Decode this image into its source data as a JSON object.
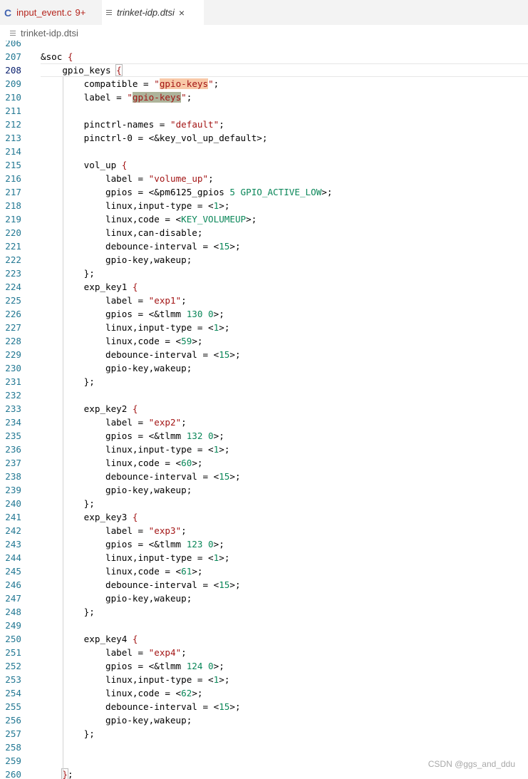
{
  "tabs": [
    {
      "icon": "C",
      "label": "input_event.c",
      "badge": "9+",
      "active": false
    },
    {
      "icon": "file-lines-icon",
      "label": "trinket-idp.dtsi",
      "close": "×",
      "active": true
    }
  ],
  "breadcrumb": {
    "file": "trinket-idp.dtsi"
  },
  "editor": {
    "lines": [
      {
        "n": "206",
        "t": []
      },
      {
        "n": "207",
        "t": [
          [
            "&soc ",
            ""
          ],
          [
            "{",
            "p"
          ]
        ]
      },
      {
        "n": "208",
        "t": [
          [
            "    gpio_keys ",
            ""
          ],
          [
            "{",
            "cursor"
          ]
        ]
      },
      {
        "n": "209",
        "t": [
          [
            "        compatible = ",
            ""
          ],
          [
            "\"",
            "s"
          ],
          [
            "gpio-keys",
            "hl1"
          ],
          [
            "\"",
            "s"
          ],
          [
            ";",
            ""
          ]
        ]
      },
      {
        "n": "210",
        "t": [
          [
            "        label = ",
            ""
          ],
          [
            "\"",
            "s"
          ],
          [
            "gpio-keys",
            "hl2"
          ],
          [
            "\"",
            "s"
          ],
          [
            ";",
            ""
          ]
        ]
      },
      {
        "n": "211",
        "t": []
      },
      {
        "n": "212",
        "t": [
          [
            "        pinctrl-names = ",
            ""
          ],
          [
            "\"default\"",
            "s"
          ],
          [
            ";",
            ""
          ]
        ]
      },
      {
        "n": "213",
        "t": [
          [
            "        pinctrl-0 = <&key_vol_up_default>;",
            ""
          ]
        ]
      },
      {
        "n": "214",
        "t": []
      },
      {
        "n": "215",
        "t": [
          [
            "        vol_up ",
            ""
          ],
          [
            "{",
            "p"
          ]
        ]
      },
      {
        "n": "216",
        "t": [
          [
            "            label = ",
            ""
          ],
          [
            "\"volume_up\"",
            "s"
          ],
          [
            ";",
            ""
          ]
        ]
      },
      {
        "n": "217",
        "t": [
          [
            "            gpios = <&pm6125_gpios ",
            ""
          ],
          [
            "5 GPIO_ACTIVE_LOW",
            "n"
          ],
          [
            ">;",
            ""
          ]
        ]
      },
      {
        "n": "218",
        "t": [
          [
            "            linux,input-type = <",
            ""
          ],
          [
            "1",
            "n"
          ],
          [
            ">;",
            ""
          ]
        ]
      },
      {
        "n": "219",
        "t": [
          [
            "            linux,code = <",
            ""
          ],
          [
            "KEY_VOLUMEUP",
            "n"
          ],
          [
            ">;",
            ""
          ]
        ]
      },
      {
        "n": "220",
        "t": [
          [
            "            linux,can-disable;",
            ""
          ]
        ]
      },
      {
        "n": "221",
        "t": [
          [
            "            debounce-interval = <",
            ""
          ],
          [
            "15",
            "n"
          ],
          [
            ">;",
            ""
          ]
        ]
      },
      {
        "n": "222",
        "t": [
          [
            "            gpio-key,wakeup;",
            ""
          ]
        ]
      },
      {
        "n": "223",
        "t": [
          [
            "        };",
            ""
          ]
        ]
      },
      {
        "n": "224",
        "t": [
          [
            "        exp_key1 ",
            ""
          ],
          [
            "{",
            "p"
          ]
        ]
      },
      {
        "n": "225",
        "t": [
          [
            "            label = ",
            ""
          ],
          [
            "\"exp1\"",
            "s"
          ],
          [
            ";",
            ""
          ]
        ]
      },
      {
        "n": "226",
        "t": [
          [
            "            gpios = <&tlmm ",
            ""
          ],
          [
            "130 0",
            "n"
          ],
          [
            ">;",
            ""
          ]
        ]
      },
      {
        "n": "227",
        "t": [
          [
            "            linux,input-type = <",
            ""
          ],
          [
            "1",
            "n"
          ],
          [
            ">;",
            ""
          ]
        ]
      },
      {
        "n": "228",
        "t": [
          [
            "            linux,code = <",
            ""
          ],
          [
            "59",
            "n"
          ],
          [
            ">;",
            ""
          ]
        ]
      },
      {
        "n": "229",
        "t": [
          [
            "            debounce-interval = <",
            ""
          ],
          [
            "15",
            "n"
          ],
          [
            ">;",
            ""
          ]
        ]
      },
      {
        "n": "230",
        "t": [
          [
            "            gpio-key,wakeup;",
            ""
          ]
        ]
      },
      {
        "n": "231",
        "t": [
          [
            "        };",
            ""
          ]
        ]
      },
      {
        "n": "232",
        "t": []
      },
      {
        "n": "233",
        "t": [
          [
            "        exp_key2 ",
            ""
          ],
          [
            "{",
            "p"
          ]
        ]
      },
      {
        "n": "234",
        "t": [
          [
            "            label = ",
            ""
          ],
          [
            "\"exp2\"",
            "s"
          ],
          [
            ";",
            ""
          ]
        ]
      },
      {
        "n": "235",
        "t": [
          [
            "            gpios = <&tlmm ",
            ""
          ],
          [
            "132 0",
            "n"
          ],
          [
            ">;",
            ""
          ]
        ]
      },
      {
        "n": "236",
        "t": [
          [
            "            linux,input-type = <",
            ""
          ],
          [
            "1",
            "n"
          ],
          [
            ">;",
            ""
          ]
        ]
      },
      {
        "n": "237",
        "t": [
          [
            "            linux,code = <",
            ""
          ],
          [
            "60",
            "n"
          ],
          [
            ">;",
            ""
          ]
        ]
      },
      {
        "n": "238",
        "t": [
          [
            "            debounce-interval = <",
            ""
          ],
          [
            "15",
            "n"
          ],
          [
            ">;",
            ""
          ]
        ]
      },
      {
        "n": "239",
        "t": [
          [
            "            gpio-key,wakeup;",
            ""
          ]
        ]
      },
      {
        "n": "240",
        "t": [
          [
            "        };",
            ""
          ]
        ]
      },
      {
        "n": "241",
        "t": [
          [
            "        exp_key3 ",
            ""
          ],
          [
            "{",
            "p"
          ]
        ]
      },
      {
        "n": "242",
        "t": [
          [
            "            label = ",
            ""
          ],
          [
            "\"exp3\"",
            "s"
          ],
          [
            ";",
            ""
          ]
        ]
      },
      {
        "n": "243",
        "t": [
          [
            "            gpios = <&tlmm ",
            ""
          ],
          [
            "123 0",
            "n"
          ],
          [
            ">;",
            ""
          ]
        ]
      },
      {
        "n": "244",
        "t": [
          [
            "            linux,input-type = <",
            ""
          ],
          [
            "1",
            "n"
          ],
          [
            ">;",
            ""
          ]
        ]
      },
      {
        "n": "245",
        "t": [
          [
            "            linux,code = <",
            ""
          ],
          [
            "61",
            "n"
          ],
          [
            ">;",
            ""
          ]
        ]
      },
      {
        "n": "246",
        "t": [
          [
            "            debounce-interval = <",
            ""
          ],
          [
            "15",
            "n"
          ],
          [
            ">;",
            ""
          ]
        ]
      },
      {
        "n": "247",
        "t": [
          [
            "            gpio-key,wakeup;",
            ""
          ]
        ]
      },
      {
        "n": "248",
        "t": [
          [
            "        };",
            ""
          ]
        ]
      },
      {
        "n": "249",
        "t": []
      },
      {
        "n": "250",
        "t": [
          [
            "        exp_key4 ",
            ""
          ],
          [
            "{",
            "p"
          ]
        ]
      },
      {
        "n": "251",
        "t": [
          [
            "            label = ",
            ""
          ],
          [
            "\"exp4\"",
            "s"
          ],
          [
            ";",
            ""
          ]
        ]
      },
      {
        "n": "252",
        "t": [
          [
            "            gpios = <&tlmm ",
            ""
          ],
          [
            "124 0",
            "n"
          ],
          [
            ">;",
            ""
          ]
        ]
      },
      {
        "n": "253",
        "t": [
          [
            "            linux,input-type = <",
            ""
          ],
          [
            "1",
            "n"
          ],
          [
            ">;",
            ""
          ]
        ]
      },
      {
        "n": "254",
        "t": [
          [
            "            linux,code = <",
            ""
          ],
          [
            "62",
            "n"
          ],
          [
            ">;",
            ""
          ]
        ]
      },
      {
        "n": "255",
        "t": [
          [
            "            debounce-interval = <",
            ""
          ],
          [
            "15",
            "n"
          ],
          [
            ">;",
            ""
          ]
        ]
      },
      {
        "n": "256",
        "t": [
          [
            "            gpio-key,wakeup;",
            ""
          ]
        ]
      },
      {
        "n": "257",
        "t": [
          [
            "        };",
            ""
          ]
        ]
      },
      {
        "n": "258",
        "t": []
      },
      {
        "n": "259",
        "t": []
      },
      {
        "n": "260",
        "t": [
          [
            "    ",
            ""
          ],
          [
            "}",
            "cursor"
          ],
          [
            ";",
            ""
          ]
        ]
      }
    ],
    "active_line": "208"
  },
  "watermark": "CSDN @ggs_and_ddu"
}
